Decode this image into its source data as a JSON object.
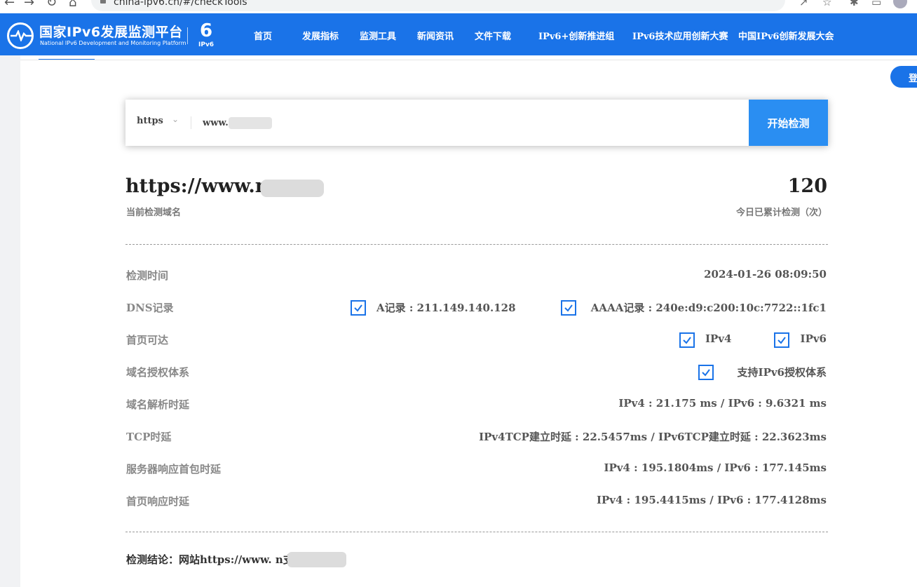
{
  "browser": {
    "url": "china-ipv6.cn/#/checkTools",
    "icons": [
      "back-icon",
      "forward-icon",
      "reload-icon",
      "home-icon",
      "lock-icon",
      "share-icon",
      "star-icon",
      "extensions-icon",
      "split-icon",
      "profile-icon"
    ]
  },
  "header": {
    "logo_cn": "国家IPv6发展监测平台",
    "logo_en": "National IPv6 Development and Monitoring Platform",
    "ipv6_mark": "IPv6",
    "nav": [
      "首页",
      "发展指标",
      "监测工具",
      "新闻资讯",
      "文件下载",
      "IPv6+创新推进组",
      "IPv6技术应用创新大赛",
      "中国IPv6创新发展大会"
    ],
    "login": "登"
  },
  "search": {
    "protocol": "https",
    "domain_value": "www.        n",
    "button": "开始检测"
  },
  "summary": {
    "domain": "https://www.m          n",
    "domain_caption": "当前检测域名",
    "count": "120",
    "count_caption": "今日已累计检测（次）"
  },
  "rows": {
    "time": {
      "label": "检测时间",
      "value": "2024-01-26 08:09:50"
    },
    "dns": {
      "label": "DNS记录",
      "a": "A记录 : 211.149.140.128",
      "aaaa": "AAAA记录 : 240e:d9:c200:10c:7722::1fc1"
    },
    "reach": {
      "label": "首页可达",
      "v4": "IPv4",
      "v6": "IPv6"
    },
    "auth": {
      "label": "域名授权体系",
      "value": "支持IPv6授权体系"
    },
    "resolve": {
      "label": "域名解析时延",
      "value": "IPv4 : 21.175 ms / IPv6 : 9.6321 ms"
    },
    "tcp": {
      "label": "TCP时延",
      "value": "IPv4TCP建立时延 : 22.5457ms / IPv6TCP建立时延 : 22.3623ms"
    },
    "firstpkt": {
      "label": "服务器响应首包时延",
      "value": "IPv4 : 195.1804ms / IPv6 : 177.145ms"
    },
    "homepage": {
      "label": "首页响应时延",
      "value": "IPv4 : 195.4415ms / IPv6 : 177.4128ms"
    }
  },
  "conclusion": "检测结论：网站https://www.          n支持IPv6",
  "colors": {
    "brand": "#1a73e8",
    "button": "#2a8ef2"
  }
}
